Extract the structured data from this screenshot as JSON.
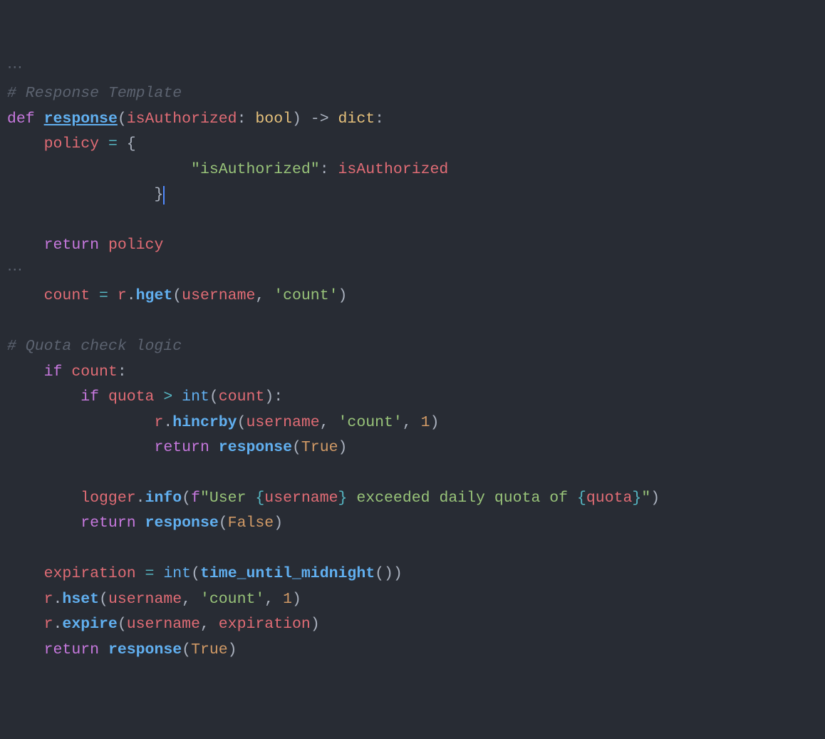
{
  "fold1": "⋯",
  "c1": "# Response Template",
  "l2": {
    "def": "def",
    "sp": " ",
    "fn": "response",
    "lp": "(",
    "p1": "isAuthorized",
    "col1": ": ",
    "t1": "bool",
    "rp": ")",
    "arr": " -> ",
    "t2": "dict",
    "end": ":"
  },
  "l3": {
    "ind": "    ",
    "v": "policy",
    "sp": " ",
    "eq": "=",
    "sp2": " ",
    "br": "{"
  },
  "l4": {
    "ind": "                    ",
    "k": "\"isAuthorized\"",
    "col": ": ",
    "v": "isAuthorized"
  },
  "l5": {
    "ind": "                ",
    "br": "}"
  },
  "l6": "",
  "l7": {
    "ind": "    ",
    "kw": "return",
    "sp": " ",
    "v": "policy"
  },
  "fold2": "⋯",
  "l8": {
    "ind": "    ",
    "v": "count",
    "sp": " ",
    "eq": "=",
    "sp2": " ",
    "r": "r",
    "dot": ".",
    "fn": "hget",
    "lp": "(",
    "a1": "username",
    "c": ", ",
    "a2": "'count'",
    "rp": ")"
  },
  "l9": "",
  "c2": "# Quota check logic",
  "l10": {
    "ind": "    ",
    "kw": "if",
    "sp": " ",
    "v": "count",
    "col": ":"
  },
  "l11": {
    "ind": "        ",
    "kw": "if",
    "sp": " ",
    "v1": "quota",
    "sp2": " ",
    "op": ">",
    "sp3": " ",
    "fn": "int",
    "lp": "(",
    "v2": "count",
    "rp": ")",
    "col": ":"
  },
  "l12": {
    "ind": "                ",
    "r": "r",
    "dot": ".",
    "fn": "hincrby",
    "lp": "(",
    "a1": "username",
    "c1": ", ",
    "a2": "'count'",
    "c2": ", ",
    "a3": "1",
    "rp": ")"
  },
  "l13": {
    "ind": "                ",
    "kw": "return",
    "sp": " ",
    "fn": "response",
    "lp": "(",
    "v": "True",
    "rp": ")"
  },
  "l14": "",
  "l15": {
    "ind": "        ",
    "o": "logger",
    "dot": ".",
    "fn": "info",
    "lp": "(",
    "pf": "f",
    "s1": "\"User ",
    "br1": "{",
    "v1": "username",
    "br2": "}",
    "s2": " exceeded daily quota of ",
    "br3": "{",
    "v2": "quota",
    "br4": "}",
    "s3": "\"",
    "rp": ")"
  },
  "l16": {
    "ind": "        ",
    "kw": "return",
    "sp": " ",
    "fn": "response",
    "lp": "(",
    "v": "False",
    "rp": ")"
  },
  "l17": "",
  "l18": {
    "ind": "    ",
    "v": "expiration",
    "sp": " ",
    "eq": "=",
    "sp2": " ",
    "fn": "int",
    "lp": "(",
    "fn2": "time_until_midnight",
    "lp2": "(",
    "rp2": ")",
    "rp": ")"
  },
  "l19": {
    "ind": "    ",
    "r": "r",
    "dot": ".",
    "fn": "hset",
    "lp": "(",
    "a1": "username",
    "c1": ", ",
    "a2": "'count'",
    "c2": ", ",
    "a3": "1",
    "rp": ")"
  },
  "l20": {
    "ind": "    ",
    "r": "r",
    "dot": ".",
    "fn": "expire",
    "lp": "(",
    "a1": "username",
    "c1": ", ",
    "a2": "expiration",
    "rp": ")"
  },
  "l21": {
    "ind": "    ",
    "kw": "return",
    "sp": " ",
    "fn": "response",
    "lp": "(",
    "v": "True",
    "rp": ")"
  }
}
